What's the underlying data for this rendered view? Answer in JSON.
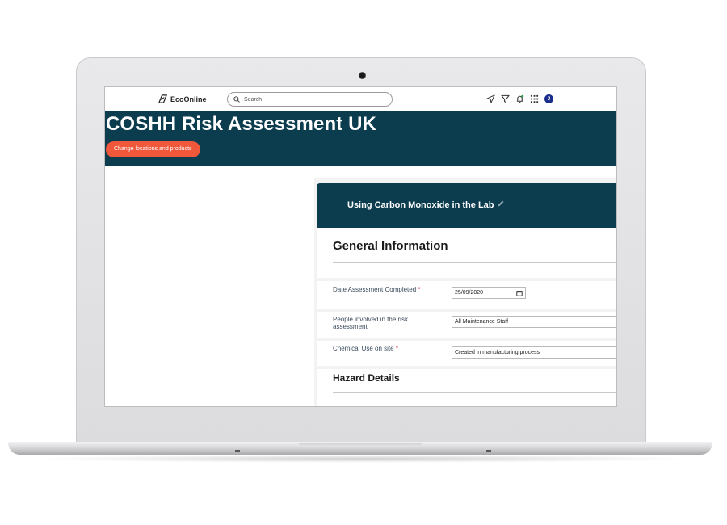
{
  "app": {
    "brand": "EcoOnline",
    "search_placeholder": "Search",
    "avatar_initial": "J"
  },
  "icons": [
    "ecoonline-logo-icon",
    "search-icon",
    "send-icon",
    "filter-icon",
    "bell-icon",
    "apps-grid-icon",
    "avatar",
    "pencil-icon",
    "calendar-icon"
  ],
  "colors": {
    "banner": "#0c3d4f",
    "accent_button": "#f0573b",
    "avatar": "#1b2e8c",
    "notification_dot": "#2e9e4f",
    "required_marker": "#d0232b"
  },
  "page": {
    "title": "COSHH Risk Assessment UK",
    "change_button": "Change locations and products"
  },
  "assessment": {
    "name": "Using Carbon Monoxide in the Lab",
    "general_section": "General Information",
    "fields": [
      {
        "label": "Date Assessment Completed",
        "required": "*",
        "value": "25/09/2020"
      },
      {
        "label": "People involved in the risk assessment",
        "required": "",
        "value": "All Maintenance Staff"
      },
      {
        "label": "Chemical Use on site",
        "required": "*",
        "value": "Created in manufacturing process"
      }
    ],
    "hazard_section": "Hazard Details"
  }
}
